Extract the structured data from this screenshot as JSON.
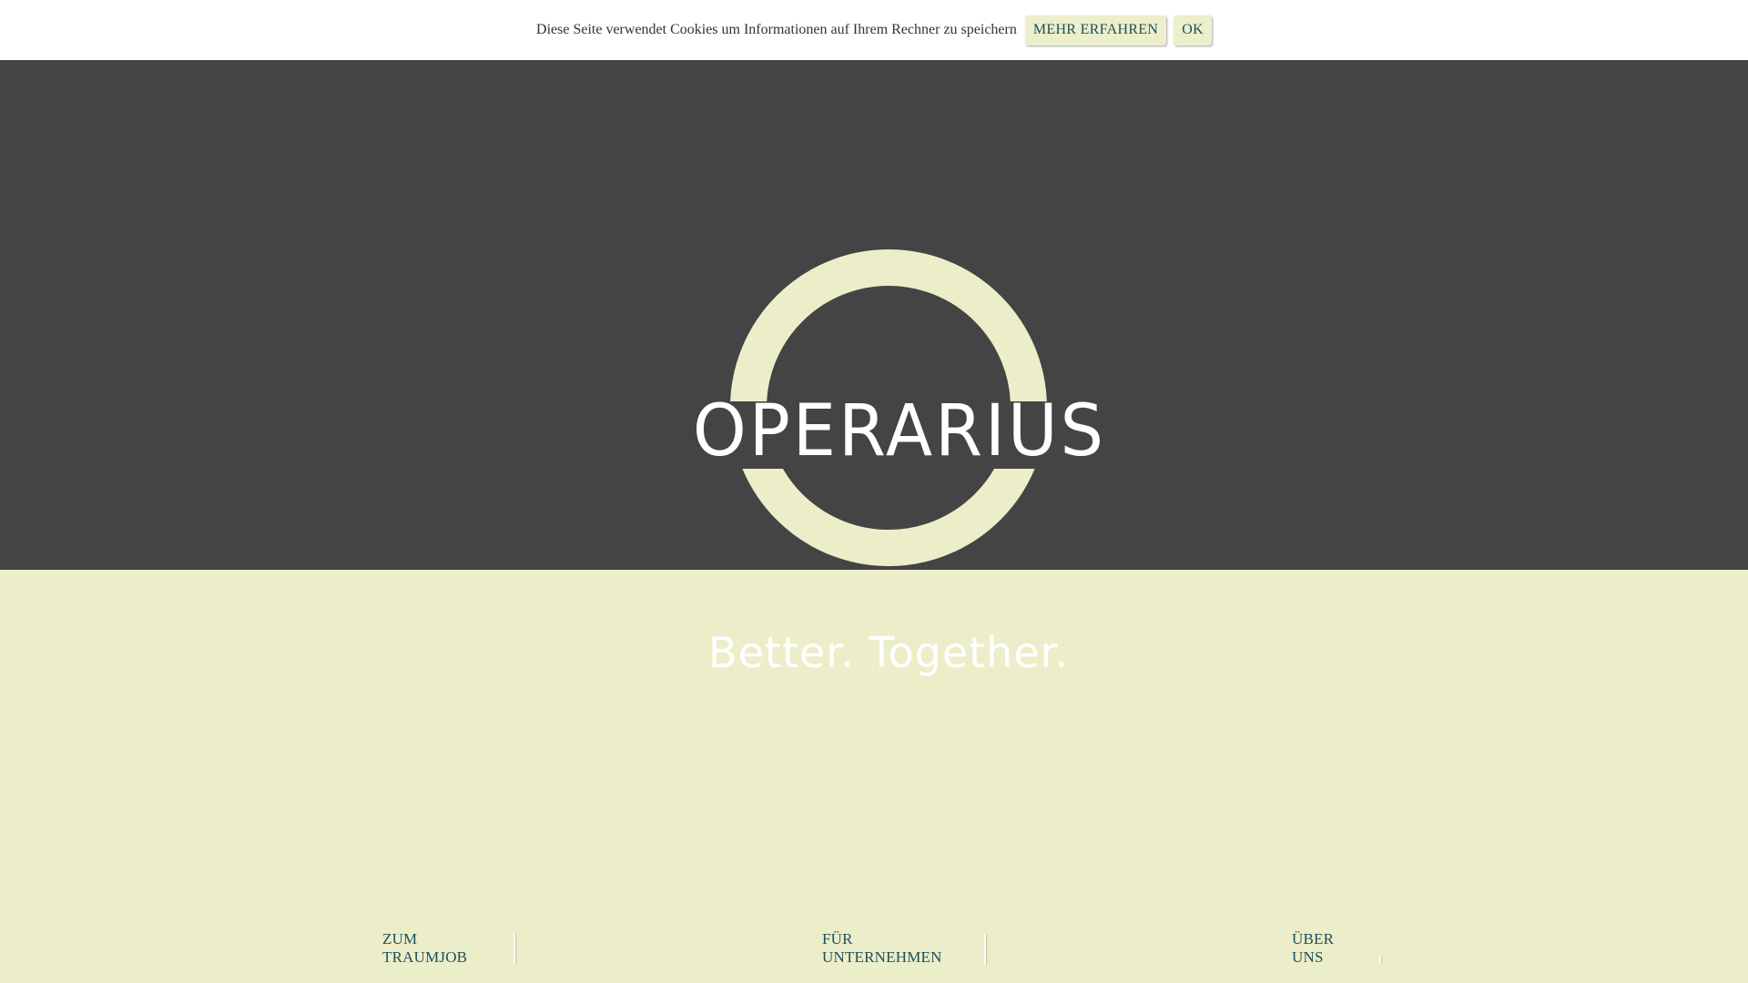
{
  "cookie_bar": {
    "message": "Diese Seite verwendet Cookies um Informationen auf Ihrem Rechner zu speichern",
    "more_label": "MEHR ERFAHREN",
    "ok_label": "OK"
  },
  "hero": {
    "logo_text": "OPERARIUS",
    "tagline": "Better. Together."
  },
  "nav": {
    "items": [
      {
        "label": "ZUM TRAUMJOB"
      },
      {
        "label": "FÜR UNTERNEHMEN"
      },
      {
        "label": "ÜBER UNS"
      }
    ]
  },
  "colors": {
    "hero_background": "#444444",
    "lower_background": "#eceec9",
    "ring": "#eceec9",
    "link_text": "#1d4f5a",
    "cookie_button_bg": "#edefcc"
  }
}
